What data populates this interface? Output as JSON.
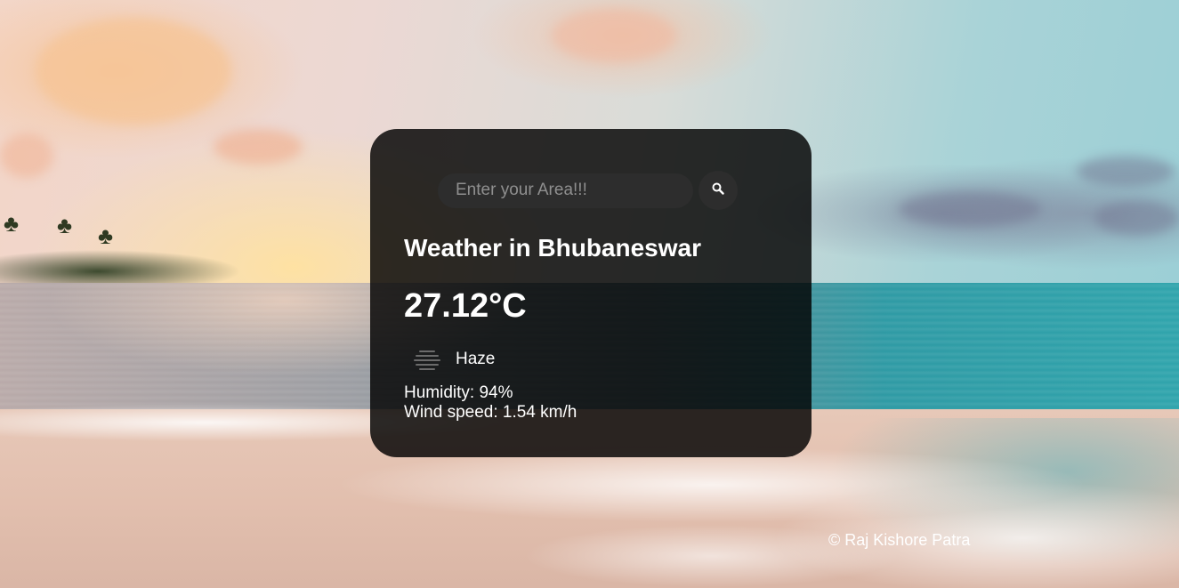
{
  "search": {
    "placeholder": "Enter your Area!!!",
    "value": ""
  },
  "weather": {
    "title": "Weather in Bhubaneswar",
    "temperature": "27.12°C",
    "condition": "Haze",
    "condition_icon": "haze-icon",
    "humidity": "Humidity: 94%",
    "wind": "Wind speed: 1.54 km/h"
  },
  "footer": {
    "credit": "© Raj Kishore Patra"
  },
  "colors": {
    "card_bg": "#000000",
    "input_bg": "#2d2d2d",
    "text": "#ffffff"
  }
}
